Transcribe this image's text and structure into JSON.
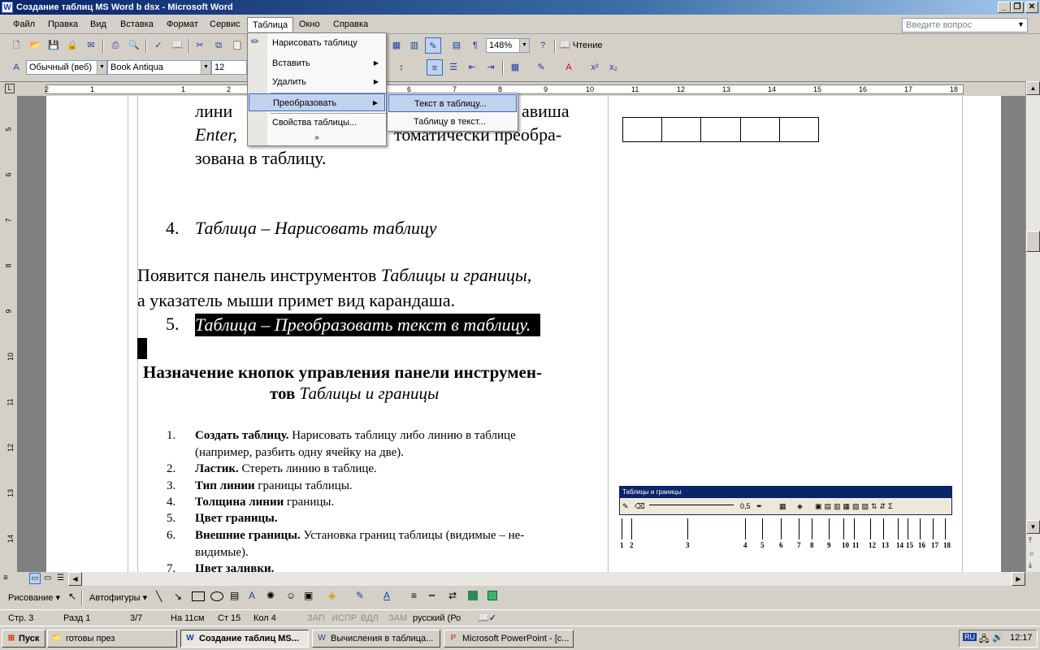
{
  "window": {
    "title": "Создание таблиц MS Word b dsx - Microsoft Word",
    "app_icon": "W",
    "controls": {
      "minimize": "_",
      "restore": "❐",
      "close": "✕"
    }
  },
  "menubar": {
    "items": [
      {
        "label": "Файл"
      },
      {
        "label": "Правка"
      },
      {
        "label": "Вид"
      },
      {
        "label": "Вставка"
      },
      {
        "label": "Формат"
      },
      {
        "label": "Сервис"
      },
      {
        "label": "Таблица"
      },
      {
        "label": "Окно"
      },
      {
        "label": "Справка"
      }
    ],
    "ask_placeholder": "Введите вопрос"
  },
  "toolbar_standard": {
    "zoom": "148%",
    "reading": "Чтение"
  },
  "toolbar_format": {
    "style": "Обычный (веб)",
    "font": "Book Antiqua",
    "size": "12"
  },
  "ruler": {
    "ticks": [
      "2",
      "1",
      "1",
      "2",
      "6",
      "7",
      "8",
      "9",
      "10",
      "11",
      "12",
      "13",
      "14",
      "15",
      "16",
      "17",
      "18"
    ],
    "vticks": [
      "5",
      "6",
      "7",
      "8",
      "9",
      "10",
      "11",
      "12",
      "13",
      "14"
    ]
  },
  "table_menu": {
    "items": [
      {
        "label": "Нарисовать таблицу"
      },
      {
        "label": "Вставить"
      },
      {
        "label": "Удалить"
      },
      {
        "label": "Преобразовать"
      },
      {
        "label": "Свойства таблицы..."
      },
      {
        "label": "»"
      }
    ]
  },
  "convert_submenu": {
    "items": [
      {
        "label": "Текст в таблицу..."
      },
      {
        "label": "Таблицу в текст..."
      }
    ]
  },
  "document": {
    "line1": "лини",
    "line1b": "авиша",
    "line2a": "Enter,",
    "line2b": "томатически преобра-",
    "line3": "зована в таблицу.",
    "item4_num": "4.",
    "item4": "Таблица – Нарисовать таблицу",
    "para1a": "Появится панель инструментов ",
    "para1b": "Таблицы и границы,",
    "para2": "а указатель мыши примет вид карандаша.",
    "item5_num": "5.",
    "item5": "Таблица – Преобразовать текст в таблицу.",
    "heading_a": "Назначение кнопок управления панели инструмен-",
    "heading_b": "тов ",
    "heading_c": "Таблицы и границы",
    "list": [
      {
        "num": "1.",
        "bold": "Создать таблицу.",
        "text": " Нарисовать таблицу либо линию в таблице"
      },
      {
        "num": "",
        "bold": "",
        "text": "(например, разбить одну ячейку на две)."
      },
      {
        "num": "2.",
        "bold": "Ластик.",
        "text": " Стереть линию в таблице."
      },
      {
        "num": "3.",
        "bold": "Тип линии",
        "text": " границы таблицы."
      },
      {
        "num": "4.",
        "bold": "Толщина линии",
        "text": " границы."
      },
      {
        "num": "5.",
        "bold": "Цвет границы.",
        "text": ""
      },
      {
        "num": "6.",
        "bold": "Внешние границы.",
        "text": " Установка границ таблицы (видимые – не-"
      },
      {
        "num": "",
        "bold": "",
        "text": "видимые)."
      },
      {
        "num": "7.",
        "bold": "Цвет заливки.",
        "text": ""
      }
    ]
  },
  "floating_toolbar": {
    "title": "Таблицы и границы",
    "weight": "0,5",
    "numbers": [
      "1",
      "2",
      "3",
      "4",
      "5",
      "6",
      "7",
      "8",
      "9",
      "10",
      "11",
      "12",
      "13",
      "14",
      "15",
      "16",
      "17",
      "18"
    ]
  },
  "drawing_toolbar": {
    "drawing": "Рисование",
    "autoshapes": "Автофигуры"
  },
  "statusbar": {
    "page": "Стр. 3",
    "section": "Разд 1",
    "pages": "3/7",
    "at": "На 11см",
    "line": "Ст 15",
    "col": "Кол 4",
    "rec": "ЗАП",
    "trk": "ИСПР",
    "ext": "ВДЛ",
    "ovr": "ЗАМ",
    "lang": "русский (Ро"
  },
  "taskbar": {
    "start": "Пуск",
    "tasks": [
      {
        "label": "готовы през"
      },
      {
        "label": "Создание таблиц MS..."
      },
      {
        "label": "Вычисления в таблица..."
      },
      {
        "label": "Microsoft PowerPoint - [c..."
      }
    ],
    "lang": "RU",
    "time": "12:17"
  }
}
